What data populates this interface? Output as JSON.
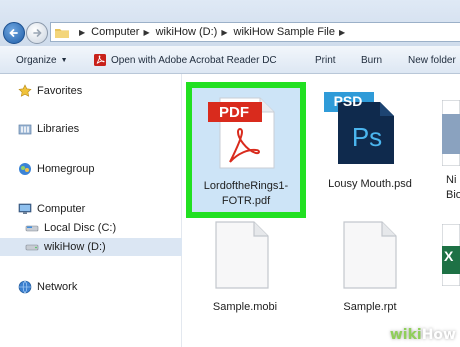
{
  "address_bar": {
    "crumbs": [
      "Computer",
      "wikiHow (D:)",
      "wikiHow Sample File"
    ],
    "icons": [
      "back-arrow-icon",
      "forward-arrow-icon",
      "folder-icon"
    ]
  },
  "toolbar": {
    "organize": "Organize",
    "open_with": "Open with Adobe Acrobat Reader DC",
    "print": "Print",
    "burn": "Burn",
    "new_folder": "New folder"
  },
  "sidebar": {
    "favorites": "Favorites",
    "libraries": "Libraries",
    "homegroup": "Homegroup",
    "computer": "Computer",
    "local_disc": "Local Disc (C:)",
    "wikihow_drive": "wikiHow (D:)",
    "network": "Network"
  },
  "files": {
    "pdf_name_line1": "LordoftheRings1-",
    "pdf_name_line2": "FOTR.pdf",
    "pdf_badge": "PDF",
    "psd_name": "Lousy Mouth.psd",
    "psd_badge": "PSD",
    "psd_logo": "Ps",
    "partial_name_line1": "Ni",
    "partial_name_line2": "Biog",
    "mobi_name": "Sample.mobi",
    "rpt_name": "Sample.rpt",
    "excel_logo": "X"
  },
  "colors": {
    "selection_highlight": "#21e021",
    "pdf_red": "#d92b1d",
    "psd_blue": "#2f9bd8",
    "psd_navy": "#0f2a4d",
    "excel_green": "#1e7145"
  },
  "watermark": {
    "wiki": "wiki",
    "how": "How"
  }
}
